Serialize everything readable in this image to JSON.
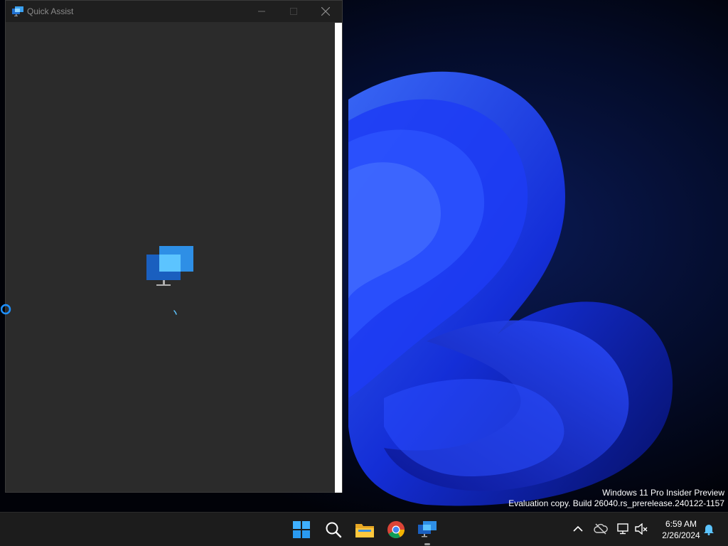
{
  "window": {
    "title": "Quick Assist",
    "icon": "quick-assist-icon",
    "controls": [
      "minimize-icon",
      "maximize-icon",
      "close-icon"
    ]
  },
  "content": {
    "logo_icon": "quick-assist-logo-icon",
    "loading": "spinner"
  },
  "watermark": {
    "line1": "Windows 11 Pro Insider Preview",
    "line2": "Evaluation copy. Build 26040.rs_prerelease.240122-1157"
  },
  "taskbar": {
    "apps": [
      "windows-start-icon",
      "search-icon",
      "file-explorer-icon",
      "chrome-icon",
      "quick-assist-icon"
    ],
    "tray": {
      "icons": [
        "chevron-up-icon",
        "cloud-off-icon",
        "network-icon",
        "volume-muted-icon",
        "bell-icon"
      ],
      "time": "6:59 AM",
      "date": "2/26/2024"
    }
  },
  "colors": {
    "window_bg": "#2b2b2b",
    "titlebar_bg": "#1f1f1f",
    "taskbar_bg": "#1c1c1c",
    "accent": "#0078d4",
    "wallpaper_blue": "#1a3cff"
  }
}
